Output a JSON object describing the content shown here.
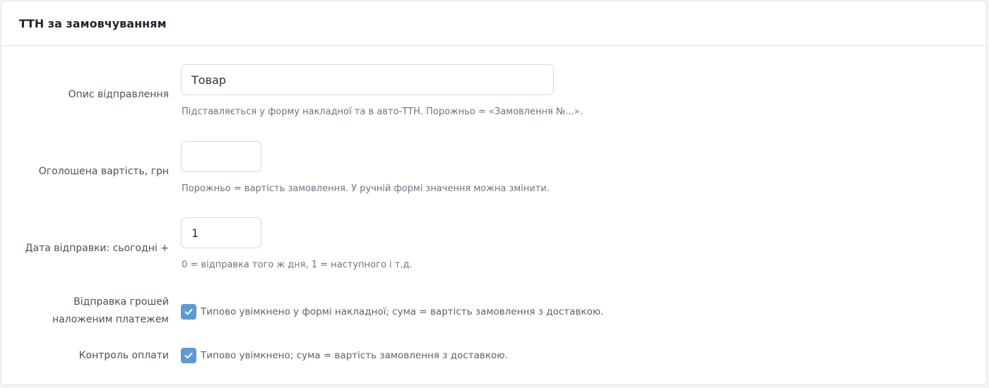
{
  "card": {
    "title": "ТТН за замовчуванням"
  },
  "fields": {
    "description": {
      "label": "Опис відправлення",
      "value": "Товар",
      "help": "Підставляється у форму накладної та в авто-ТТН. Порожньо = «Замовлення №...»."
    },
    "declared_value": {
      "label": "Оголошена вартість, грн",
      "value": "",
      "help": "Порожньо = вартість замовлення. У ручній формі значення можна змінити."
    },
    "ship_date": {
      "label": "Дата відправки: сьогодні +",
      "value": "1",
      "help": "0 = відправка того ж дня, 1 = наступного і т.д."
    },
    "cod": {
      "label_line1": "Відправка грошей",
      "label_line2": "наложеним платежем",
      "checked": true,
      "text": "Типово увімкнено у формі накладної; сума = вартість замовлення з доставкою."
    },
    "payment_control": {
      "label": "Контроль оплати",
      "checked": true,
      "text": "Типово увімкнено; сума = вартість замовлення з доставкою."
    }
  },
  "colors": {
    "accent": "#5b9bd5",
    "border": "#d3d8de"
  }
}
